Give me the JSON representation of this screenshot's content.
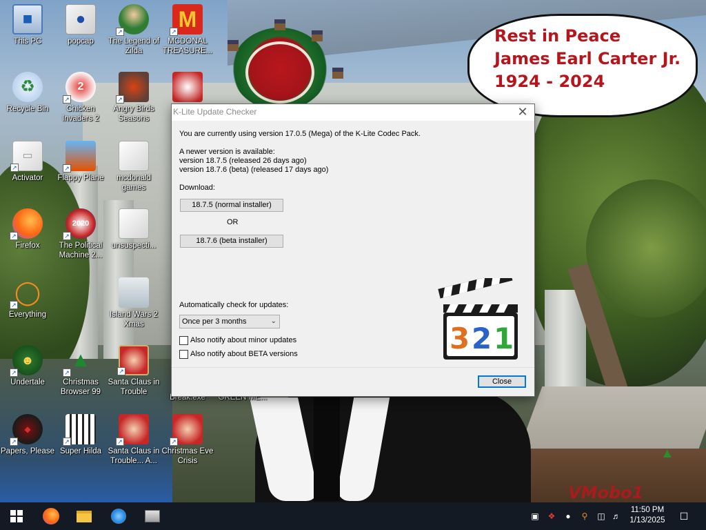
{
  "dialog": {
    "title": "K-Lite Update Checker",
    "current_version_text": "You are currently using version 17.0.5 (Mega) of the K-Lite Codec Pack.",
    "newer_available_text": "A newer version is available:",
    "version_normal_text": "version 18.7.5  (released 26 days ago)",
    "version_beta_text": "version 18.7.6  (beta)  (released 17 days ago)",
    "download_label": "Download:",
    "normal_installer_button": "18.7.5 (normal installer)",
    "or_text": "OR",
    "beta_installer_button": "18.7.6 (beta installer)",
    "auto_check_label": "Automatically check for updates:",
    "frequency_selected": "Once per 3 months",
    "minor_updates_label": "Also notify about minor updates",
    "beta_versions_label": "Also notify about BETA versions",
    "close_button": "Close",
    "logo_digits": [
      "3",
      "2",
      "1"
    ]
  },
  "desktop_icons": [
    {
      "label": "This PC",
      "icon": "computer-icon"
    },
    {
      "label": "Recycle Bin",
      "icon": "recycle-bin-icon"
    },
    {
      "label": "Activator",
      "icon": "folder-icon"
    },
    {
      "label": "Firefox",
      "icon": "firefox-icon"
    },
    {
      "label": "Everything",
      "icon": "search-icon"
    },
    {
      "label": "Undertale",
      "icon": "game-icon"
    },
    {
      "label": "Papers, Please",
      "icon": "game-icon"
    },
    {
      "label": "popcap",
      "icon": "folder-icon"
    },
    {
      "label": "Chicken Invaders 2",
      "icon": "game-icon"
    },
    {
      "label": "Flappy Plane",
      "icon": "game-icon"
    },
    {
      "label": "The Political Machine 2...",
      "icon": "game-icon"
    },
    {
      "label": "Christmas Browser 99",
      "icon": "tree-icon"
    },
    {
      "label": "Super Hilda",
      "icon": "game-icon"
    },
    {
      "label": "The Legend of Zilda",
      "icon": "game-icon"
    },
    {
      "label": "Angry Birds Seasons",
      "icon": "game-icon"
    },
    {
      "label": "mcdonald games",
      "icon": "folder-icon"
    },
    {
      "label": "unsuspecti...",
      "icon": "folder-icon"
    },
    {
      "label": "Island Wars 2 Xmas",
      "icon": "game-icon"
    },
    {
      "label": "Santa Claus in Trouble",
      "icon": "game-icon"
    },
    {
      "label": "Santa Claus in Trouble... A...",
      "icon": "game-icon"
    },
    {
      "label": "MCDONAL TREASURE...",
      "icon": "mcdonalds-icon"
    },
    {
      "label": "Christmas Eve Crisis",
      "icon": "game-icon"
    },
    {
      "label": "Break.exe",
      "icon": "game-icon"
    },
    {
      "label": "GREEN ME...",
      "icon": "game-icon"
    }
  ],
  "bubble": {
    "line1": "Rest in Peace",
    "line2": "James Earl Carter Jr.",
    "line3": "1924 - 2024"
  },
  "watermark": "VMobo1",
  "taskbar": {
    "time": "11:50 PM",
    "date": "1/13/2025"
  },
  "colors": {
    "bubble_text": "#b5161c",
    "taskbar": "#131a24",
    "dialog_bg": "#f0f0f0",
    "accent": "#0078d7"
  }
}
